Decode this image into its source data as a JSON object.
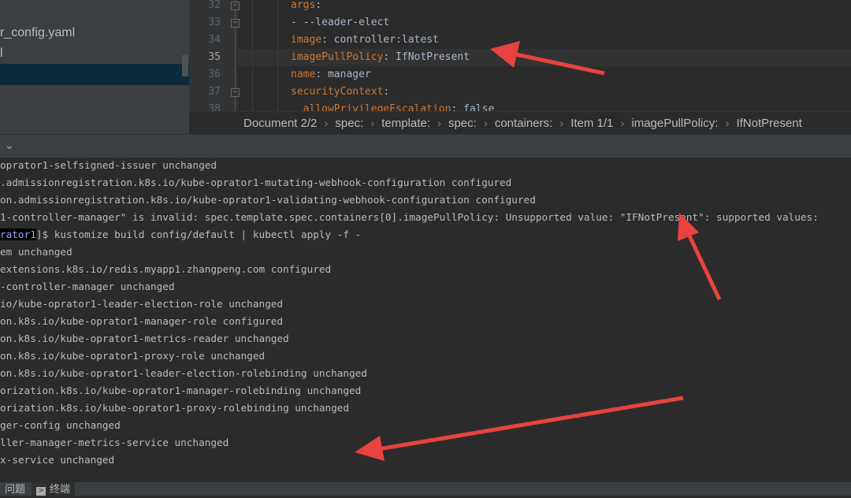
{
  "project": {
    "items": [
      "r_config.yaml",
      "l"
    ]
  },
  "editor": {
    "lines": [
      {
        "n": "32",
        "key": "args",
        "rest": ":"
      },
      {
        "n": "33",
        "key": "",
        "rest": "- --leader-elect"
      },
      {
        "n": "34",
        "key": "image",
        "rest": ": controller:latest"
      },
      {
        "n": "35",
        "key": "imagePullPolicy",
        "rest": ": IfNotPresent"
      },
      {
        "n": "36",
        "key": "name",
        "rest": ": manager"
      },
      {
        "n": "37",
        "key": "securityContext",
        "rest": ":"
      },
      {
        "n": "38",
        "key": "  allowPrivilegeEscalation",
        "rest": ": false"
      }
    ],
    "current_line": "35"
  },
  "breadcrumbs": [
    "Document 2/2",
    "spec:",
    "template:",
    "spec:",
    "containers:",
    "Item 1/1",
    "imagePullPolicy:",
    "IfNotPresent"
  ],
  "terminal": {
    "lines": [
      "oprator1-selfsigned-issuer unchanged",
      ".admissionregistration.k8s.io/kube-oprator1-mutating-webhook-configuration configured",
      "on.admissionregistration.k8s.io/kube-oprator1-validating-webhook-configuration configured",
      "1-controller-manager\" is invalid: spec.template.spec.containers[0].imagePullPolicy: Unsupported value: \"IFNotPresent\": supported values:",
      "",
      "em unchanged",
      "extensions.k8s.io/redis.myapp1.zhangpeng.com configured",
      "-controller-manager unchanged",
      "io/kube-oprator1-leader-election-role unchanged",
      "on.k8s.io/kube-oprator1-manager-role configured",
      "on.k8s.io/kube-oprator1-metrics-reader unchanged",
      "on.k8s.io/kube-oprator1-proxy-role unchanged",
      "on.k8s.io/kube-oprator1-leader-election-rolebinding unchanged",
      "orization.k8s.io/kube-oprator1-manager-rolebinding unchanged",
      "orization.k8s.io/kube-oprator1-proxy-rolebinding unchanged",
      "ger-config unchanged",
      "ller-manager-metrics-service unchanged",
      "x-service unchanged"
    ],
    "prompt_dir": "rator1",
    "prompt_rest": "]$ kustomize build config/default | kubectl apply -f -"
  },
  "bottom_tabs": {
    "problems": "问题",
    "terminal": "终端"
  },
  "colors": {
    "arrow": "#e8433f",
    "key": "#cc7832",
    "selection": "#0d293e"
  }
}
